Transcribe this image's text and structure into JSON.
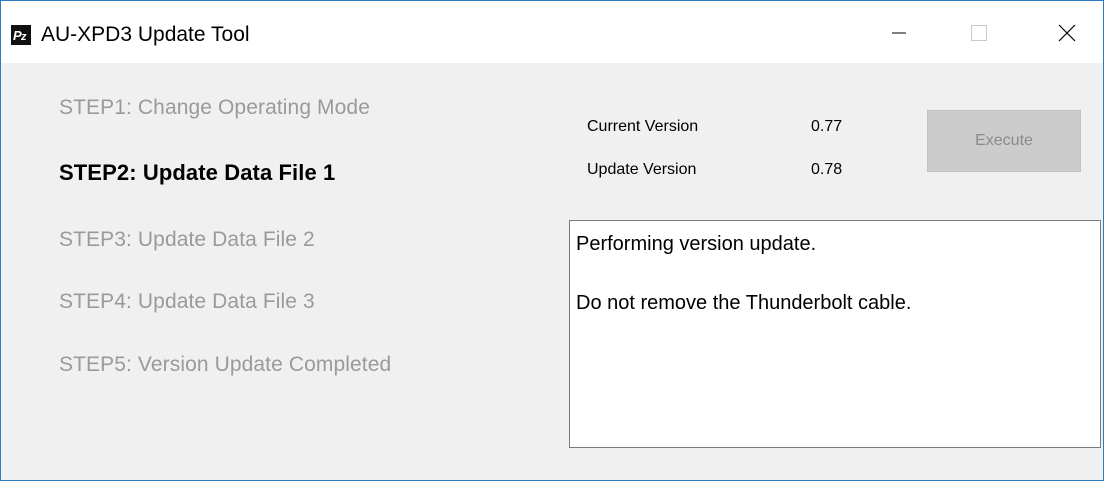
{
  "window": {
    "title": "AU-XPD3 Update Tool",
    "accent_border": "#2b7bbf"
  },
  "steps": [
    {
      "label": "STEP1: Change Operating Mode",
      "state": "completed"
    },
    {
      "label": "STEP2: Update Data File 1",
      "state": "active"
    },
    {
      "label": "STEP3: Update Data File 2",
      "state": "pending"
    },
    {
      "label": "STEP4: Update Data File 3",
      "state": "pending"
    },
    {
      "label": "STEP5: Version Update Completed",
      "state": "pending"
    }
  ],
  "versions": {
    "current_label": "Current Version",
    "current_value": "0.77",
    "update_label": "Update Version",
    "update_value": "0.78"
  },
  "execute_button": {
    "label": "Execute",
    "enabled": false
  },
  "log": {
    "lines": [
      "Performing version update.",
      "Do not remove the Thunderbolt cable."
    ]
  }
}
